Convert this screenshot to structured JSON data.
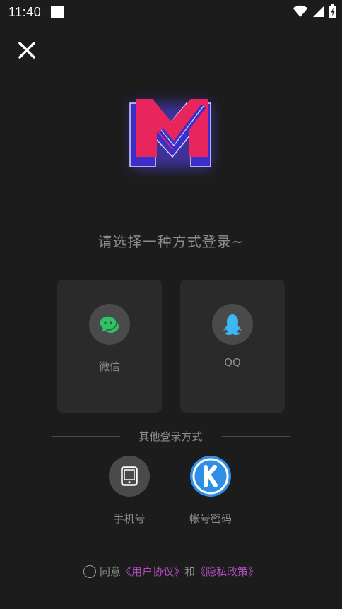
{
  "status_bar": {
    "time": "11:40"
  },
  "prompt": "请选择一种方式登录~",
  "login_cards": [
    {
      "label": "微信",
      "icon": "wechat-icon",
      "color": "#2ec466"
    },
    {
      "label": "QQ",
      "icon": "qq-icon",
      "color": "#3eb7f5"
    }
  ],
  "other_methods": {
    "title": "其他登录方式",
    "items": [
      {
        "label": "手机号",
        "icon": "phone-icon"
      },
      {
        "label": "帐号密码",
        "icon": "kugou-k-icon",
        "color": "#2f8fe6"
      }
    ]
  },
  "agreement": {
    "prefix": "同意",
    "user_agreement": "《用户协议》",
    "and": "和",
    "privacy_policy": "《隐私政策》",
    "link_color": "#b04dbb"
  },
  "colors": {
    "background": "#1c1c1d",
    "card": "#2a2a2b",
    "logo_pink": "#e8255d",
    "logo_blue": "#3a2fc8"
  }
}
